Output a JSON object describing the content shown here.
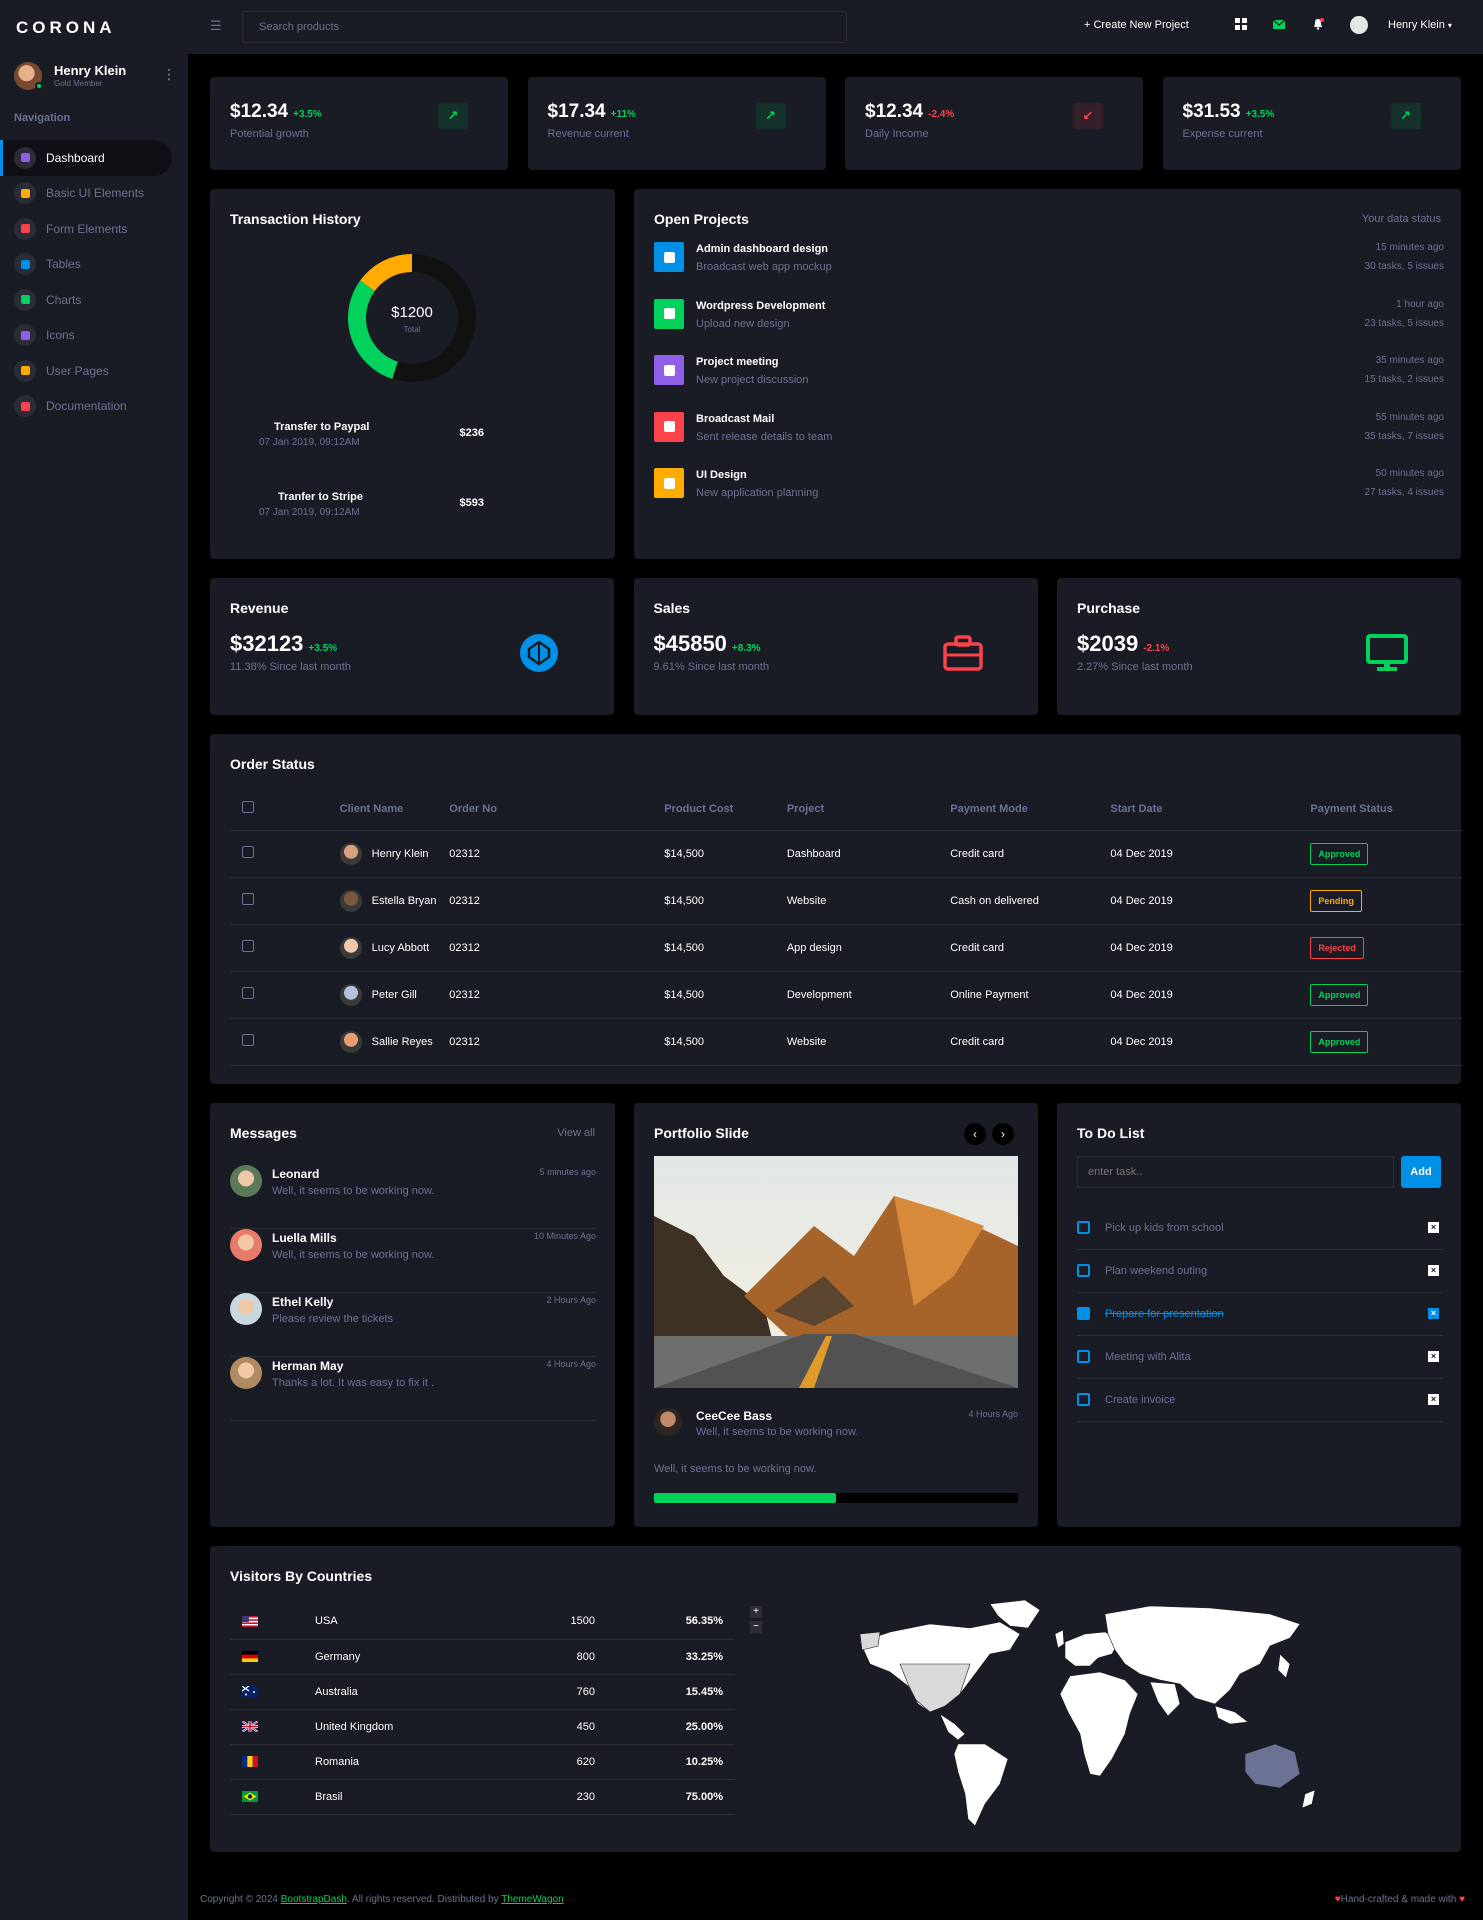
{
  "brand": "CORONA",
  "profile": {
    "name": "Henry Klein",
    "role": "Gold Member"
  },
  "nav": {
    "heading": "Navigation",
    "items": [
      {
        "label": "Dashboard",
        "color": "#8f5fe8"
      },
      {
        "label": "Basic UI Elements",
        "color": "#ffab00"
      },
      {
        "label": "Form Elements",
        "color": "#fc424a"
      },
      {
        "label": "Tables",
        "color": "#0090e7"
      },
      {
        "label": "Charts",
        "color": "#00d25b"
      },
      {
        "label": "Icons",
        "color": "#8f5fe8"
      },
      {
        "label": "User Pages",
        "color": "#ffab00"
      },
      {
        "label": "Documentation",
        "color": "#fc424a"
      }
    ]
  },
  "topbar": {
    "search_placeholder": "Search products",
    "create_label": "+ Create New Project",
    "user_name": "Henry Klein"
  },
  "stats": [
    {
      "value": "$12.34",
      "pct": "+3.5%",
      "label": "Potential growth",
      "trend": "up"
    },
    {
      "value": "$17.34",
      "pct": "+11%",
      "label": "Revenue current",
      "trend": "up"
    },
    {
      "value": "$12.34",
      "pct": "-2.4%",
      "label": "Daily Income",
      "trend": "down"
    },
    {
      "value": "$31.53",
      "pct": "+3.5%",
      "label": "Expense current",
      "trend": "up"
    }
  ],
  "transactions": {
    "title": "Transaction History",
    "total": "$1200",
    "total_label": "Total",
    "chart_data": {
      "type": "pie",
      "values": [
        55,
        30,
        15
      ],
      "colors": [
        "#111111",
        "#00d25b",
        "#ffab00"
      ]
    },
    "items": [
      {
        "name": "Transfer to Paypal",
        "date": "07 Jan 2019, 09:12AM",
        "amount": "$236"
      },
      {
        "name": "Tranfer to Stripe",
        "date": "07 Jan 2019, 09:12AM",
        "amount": "$593"
      }
    ]
  },
  "projects": {
    "title": "Open Projects",
    "status": "Your data status",
    "items": [
      {
        "title": "Admin dashboard design",
        "sub": "Broadcast web app mockup",
        "time": "15 minutes ago",
        "meta": "30 tasks, 5 issues",
        "color": "#0090e7"
      },
      {
        "title": "Wordpress Development",
        "sub": "Upload new design",
        "time": "1 hour ago",
        "meta": "23 tasks, 5 issues",
        "color": "#00d25b"
      },
      {
        "title": "Project meeting",
        "sub": "New project discussion",
        "time": "35 minutes ago",
        "meta": "15 tasks, 2 issues",
        "color": "#8f5fe8"
      },
      {
        "title": "Broadcast Mail",
        "sub": "Sent release details to team",
        "time": "55 minutes ago",
        "meta": "35 tasks, 7 issues",
        "color": "#fc424a"
      },
      {
        "title": "UI Design",
        "sub": "New application planning",
        "time": "50 minutes ago",
        "meta": "27 tasks, 4 issues",
        "color": "#ffab00"
      }
    ]
  },
  "summary": [
    {
      "title": "Revenue",
      "value": "$32123",
      "pct": "+3.5%",
      "label": "11.38% Since last month",
      "trend": "up"
    },
    {
      "title": "Sales",
      "value": "$45850",
      "pct": "+8.3%",
      "label": "9.61% Since last month",
      "trend": "up"
    },
    {
      "title": "Purchase",
      "value": "$2039",
      "pct": "-2.1%",
      "label": "2.27% Since last month",
      "trend": "down"
    }
  ],
  "orders": {
    "title": "Order Status",
    "headers": [
      "Client Name",
      "Order No",
      "Product Cost",
      "Project",
      "Payment Mode",
      "Start Date",
      "Payment Status"
    ],
    "rows": [
      {
        "client": "Henry Klein",
        "order": "02312",
        "cost": "$14,500",
        "project": "Dashboard",
        "mode": "Credit card",
        "date": "04 Dec 2019",
        "status": "Approved"
      },
      {
        "client": "Estella Bryan",
        "order": "02312",
        "cost": "$14,500",
        "project": "Website",
        "mode": "Cash on delivered",
        "date": "04 Dec 2019",
        "status": "Pending"
      },
      {
        "client": "Lucy Abbott",
        "order": "02312",
        "cost": "$14,500",
        "project": "App design",
        "mode": "Credit card",
        "date": "04 Dec 2019",
        "status": "Rejected"
      },
      {
        "client": "Peter Gill",
        "order": "02312",
        "cost": "$14,500",
        "project": "Development",
        "mode": "Online Payment",
        "date": "04 Dec 2019",
        "status": "Approved"
      },
      {
        "client": "Sallie Reyes",
        "order": "02312",
        "cost": "$14,500",
        "project": "Website",
        "mode": "Credit card",
        "date": "04 Dec 2019",
        "status": "Approved"
      }
    ]
  },
  "messages": {
    "title": "Messages",
    "view_all": "View all",
    "items": [
      {
        "name": "Leonard",
        "text": "Well, it seems to be working now.",
        "time": "5 minutes ago"
      },
      {
        "name": "Luella Mills",
        "text": "Well, it seems to be working now.",
        "time": "10 Minutes Ago"
      },
      {
        "name": "Ethel Kelly",
        "text": "Please review the tickets",
        "time": "2 Hours Ago"
      },
      {
        "name": "Herman May",
        "text": "Thanks a lot. It was easy to fix it .",
        "time": "4 Hours Ago"
      }
    ]
  },
  "portfolio": {
    "title": "Portfolio Slide",
    "author": "CeeCee Bass",
    "author_text": "Well, it seems to be working now.",
    "time": "4 Hours Ago",
    "caption": "Well, it seems to be working now.",
    "progress": 0.5
  },
  "todo": {
    "title": "To Do List",
    "placeholder": "enter task..",
    "add_label": "Add",
    "items": [
      {
        "label": "Pick up kids from school",
        "done": false
      },
      {
        "label": "Plan weekend outing",
        "done": false
      },
      {
        "label": "Prepare for presentation",
        "done": true
      },
      {
        "label": "Meeting with Alita",
        "done": false
      },
      {
        "label": "Create invoice",
        "done": false
      }
    ]
  },
  "visitors": {
    "title": "Visitors By Countries",
    "rows": [
      {
        "country": "USA",
        "count": "1500",
        "pct": "56.35%"
      },
      {
        "country": "Germany",
        "count": "800",
        "pct": "33.25%"
      },
      {
        "country": "Australia",
        "count": "760",
        "pct": "15.45%"
      },
      {
        "country": "United Kingdom",
        "count": "450",
        "pct": "25.00%"
      },
      {
        "country": "Romania",
        "count": "620",
        "pct": "10.25%"
      },
      {
        "country": "Brasil",
        "count": "230",
        "pct": "75.00%"
      }
    ]
  },
  "footer": {
    "pre": "Copyright © 2024 ",
    "link1": "BootstrapDash",
    "mid": ". All rights reserved. Distributed by ",
    "link2": "ThemeWagon",
    "right": "Hand-crafted & made with"
  }
}
